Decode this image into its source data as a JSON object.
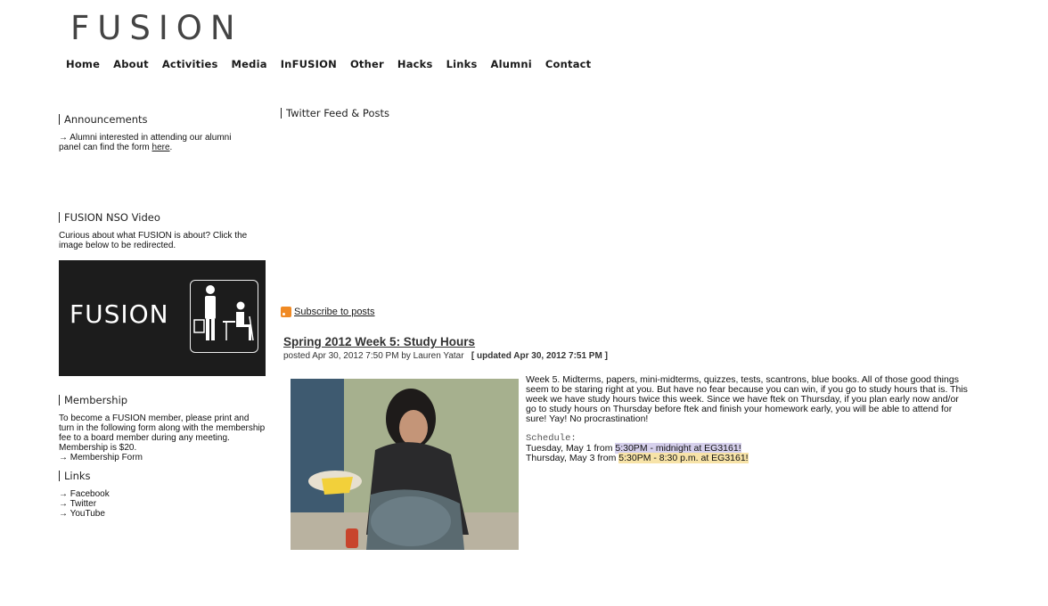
{
  "logo": "FUSION",
  "nav": {
    "items": [
      "Home",
      "About",
      "Activities",
      "Media",
      "InFUSION",
      "Other",
      "Hacks",
      "Links",
      "Alumni",
      "Contact"
    ]
  },
  "sidebar": {
    "announcements": {
      "title": "Announcements",
      "text": "→ Alumni interested in attending our alumni panel can find the form ",
      "link": "here",
      "after": "."
    },
    "nso_video": {
      "title": "FUSION NSO Video",
      "text": "Curious about what FUSION is about? Click the image below to be redirected.",
      "image_text": "FUSION"
    },
    "membership": {
      "title": "Membership",
      "text": "To become a FUSION member, please print and turn in the following form along with the membership fee to a board member during any meeting. Membership is $20.",
      "link": "→ Membership Form"
    },
    "links": {
      "title": "Links",
      "items": [
        "→ Facebook",
        "→ Twitter",
        "→ YouTube"
      ]
    }
  },
  "main": {
    "twitter_title": "Twitter Feed & Posts",
    "subscribe": "Subscribe to posts",
    "post": {
      "title": "Spring 2012 Week 5: Study Hours",
      "meta_prefix": "posted Apr 30, 2012 7:50 PM by Lauren Yatar",
      "meta_updated": "[ updated Apr 30, 2012 7:51 PM ]",
      "body": "Week 5. Midterms, papers, mini-midterms, quizzes, tests, scantrons, blue books. All of those good things seem to be staring right at you. But have no fear because you can win, if you go to study hours that is. This week we have study hours twice this week. Since we have ftek on Thursday, if you plan early now and/or go to study hours on Thursday before ftek and finish your homework early, you will be able to attend for sure! Yay! No procrastination!",
      "schedule_label": "Schedule:",
      "schedule": [
        {
          "prefix": "Tuesday, May 1 from ",
          "highlight": "5:30PM - midnight at EG3161!"
        },
        {
          "prefix": "Thursday, May 3 from ",
          "highlight": "5:30PM - 8:30 p.m. at EG3161!"
        }
      ]
    }
  }
}
